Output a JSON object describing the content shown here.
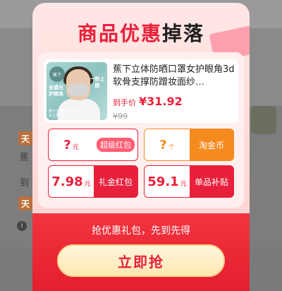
{
  "background": {
    "labels": [
      "天",
      "蕉",
      "到",
      "天"
    ],
    "info_icon": "i"
  },
  "popup": {
    "title_red": "商品优惠",
    "title_dark": "掉落",
    "product": {
      "name": "蕉下立体防晒口罩女护眼角3d软骨支撑防蹭妆面纱…",
      "price_label": "到手价",
      "price_value": "¥31.92",
      "original_price": "¥99",
      "thumb_badge": "蕉下",
      "thumb_tag_left": "全遮光护眼角",
      "thumb_tag_right": "一秒上脸",
      "thumb_foot": "蕉下立体防晒口罩 L 女士鼻护款"
    },
    "coupons": [
      {
        "value": "?",
        "unit": "元",
        "label": "超级红包"
      },
      {
        "value": "?",
        "unit": "个",
        "label": "淘金币"
      },
      {
        "value": "7.98",
        "unit": "元",
        "label": "礼金红包"
      },
      {
        "value": "59.1",
        "unit": "元",
        "label": "单品补贴"
      }
    ],
    "bottom_text": "抢优惠礼包，先到先得",
    "cta_label": "立即抢"
  },
  "colors": {
    "accent_red": "#e8203b",
    "accent_orange": "#f58a1f",
    "cta_bg": "#ffecc0"
  },
  "icons": {
    "info": "info-icon"
  }
}
